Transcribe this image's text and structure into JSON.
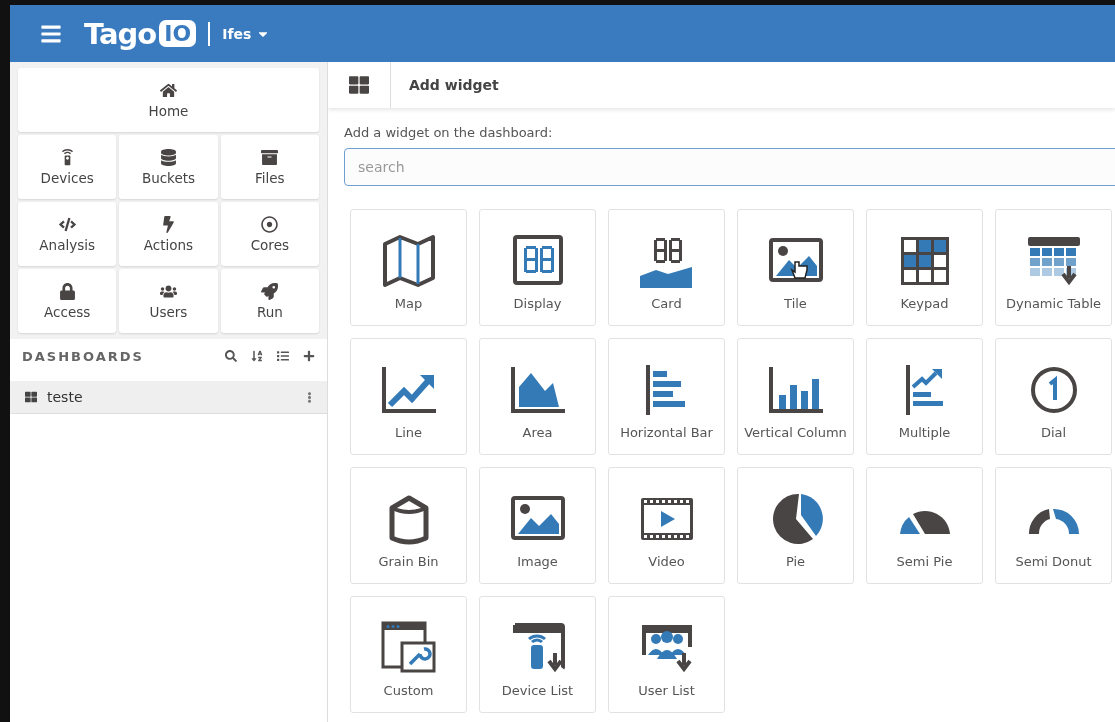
{
  "header": {
    "logo_text": "Tago",
    "logo_badge": "IO",
    "account": "Ifes"
  },
  "sidebar": {
    "nav": [
      {
        "label": "Home"
      },
      {
        "label": "Devices"
      },
      {
        "label": "Buckets"
      },
      {
        "label": "Files"
      },
      {
        "label": "Analysis"
      },
      {
        "label": "Actions"
      },
      {
        "label": "Cores"
      },
      {
        "label": "Access"
      },
      {
        "label": "Users"
      },
      {
        "label": "Run"
      }
    ],
    "dashboards_title": "DASHBOARDS",
    "dashboards": [
      {
        "name": "teste",
        "selected": true
      }
    ]
  },
  "main": {
    "title": "Add widget",
    "prompt": "Add a widget on the dashboard:",
    "search": {
      "placeholder": "search"
    },
    "widgets": [
      {
        "label": "Map"
      },
      {
        "label": "Display"
      },
      {
        "label": "Card"
      },
      {
        "label": "Tile"
      },
      {
        "label": "Keypad"
      },
      {
        "label": "Dynamic Table"
      },
      {
        "label": "Line"
      },
      {
        "label": "Area"
      },
      {
        "label": "Horizontal Bar"
      },
      {
        "label": "Vertical Column"
      },
      {
        "label": "Multiple"
      },
      {
        "label": "Dial"
      },
      {
        "label": "Grain Bin"
      },
      {
        "label": "Image"
      },
      {
        "label": "Video"
      },
      {
        "label": "Pie"
      },
      {
        "label": "Semi Pie"
      },
      {
        "label": "Semi Donut"
      },
      {
        "label": "Custom"
      },
      {
        "label": "Device List"
      },
      {
        "label": "User List"
      }
    ]
  }
}
